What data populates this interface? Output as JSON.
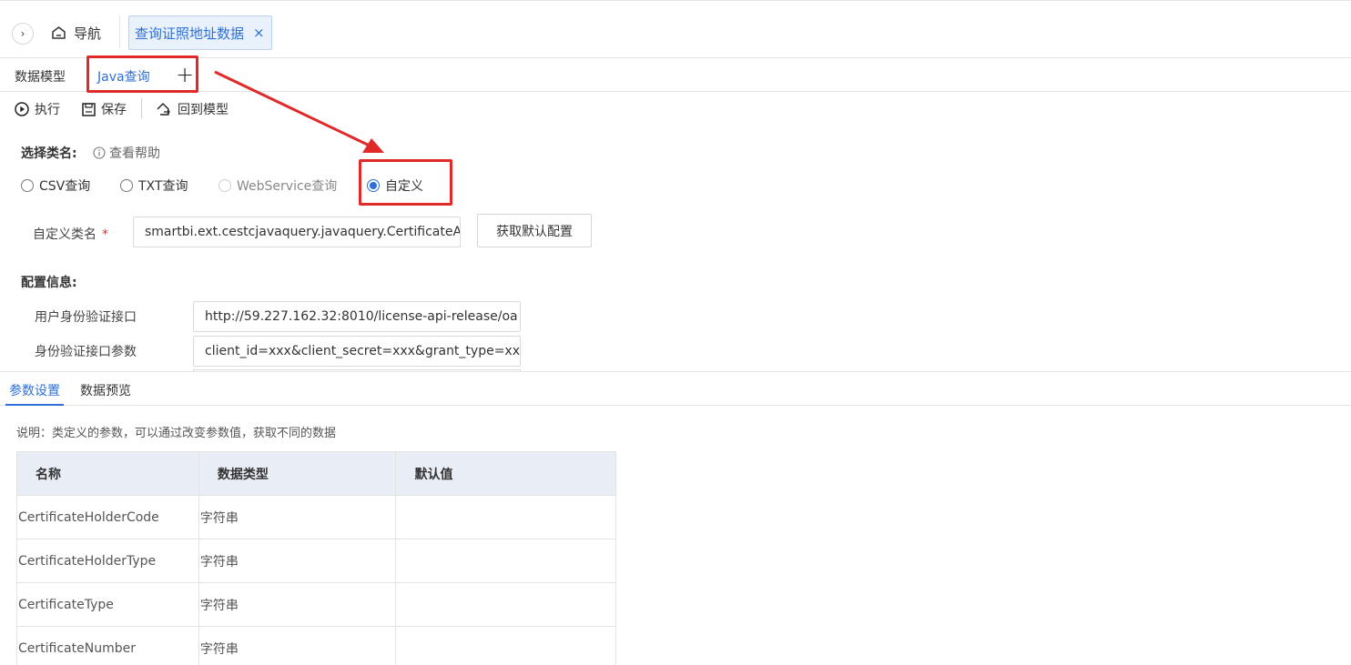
{
  "header": {
    "nav_label": "导航",
    "doc_tab_label": "查询证照地址数据"
  },
  "subtabs": {
    "items": [
      "数据模型",
      "Java查询"
    ],
    "active": "Java查询"
  },
  "toolbar": {
    "run_label": "执行",
    "save_label": "保存",
    "back_label": "回到模型"
  },
  "form": {
    "select_class_label": "选择类名:",
    "help_label": "查看帮助",
    "radios": [
      {
        "label": "CSV查询",
        "checked": false,
        "disabled": false
      },
      {
        "label": "TXT查询",
        "checked": false,
        "disabled": false
      },
      {
        "label": "WebService查询",
        "checked": false,
        "disabled": true
      },
      {
        "label": "自定义",
        "checked": true,
        "disabled": false
      }
    ],
    "class_name_label": "自定义类名",
    "required_mark": "*",
    "class_name_value": "smartbi.ext.cestcjavaquery.javaquery.CertificateA",
    "get_default_button": "获取默认配置",
    "config_label": "配置信息:",
    "auth_url_label": "用户身份验证接口",
    "auth_url_value": "http://59.227.162.32:8010/license-api-release/oa",
    "auth_params_label": "身份验证接口参数",
    "auth_params_value": "client_id=xxx&client_secret=xxx&grant_type=xxx"
  },
  "bottom": {
    "tabs": [
      "参数设置",
      "数据预览"
    ],
    "note": "说明：类定义的参数，可以通过改变参数值，获取不同的数据",
    "columns": [
      "名称",
      "数据类型",
      "默认值"
    ],
    "rows": [
      {
        "name": "CertificateHolderCode",
        "type": "字符串",
        "default": ""
      },
      {
        "name": "CertificateHolderType",
        "type": "字符串",
        "default": ""
      },
      {
        "name": "CertificateType",
        "type": "字符串",
        "default": ""
      },
      {
        "name": "CertificateNumber",
        "type": "字符串",
        "default": ""
      }
    ]
  },
  "colors": {
    "accent": "#2d6fd6",
    "annotation": "#e02a2a"
  }
}
